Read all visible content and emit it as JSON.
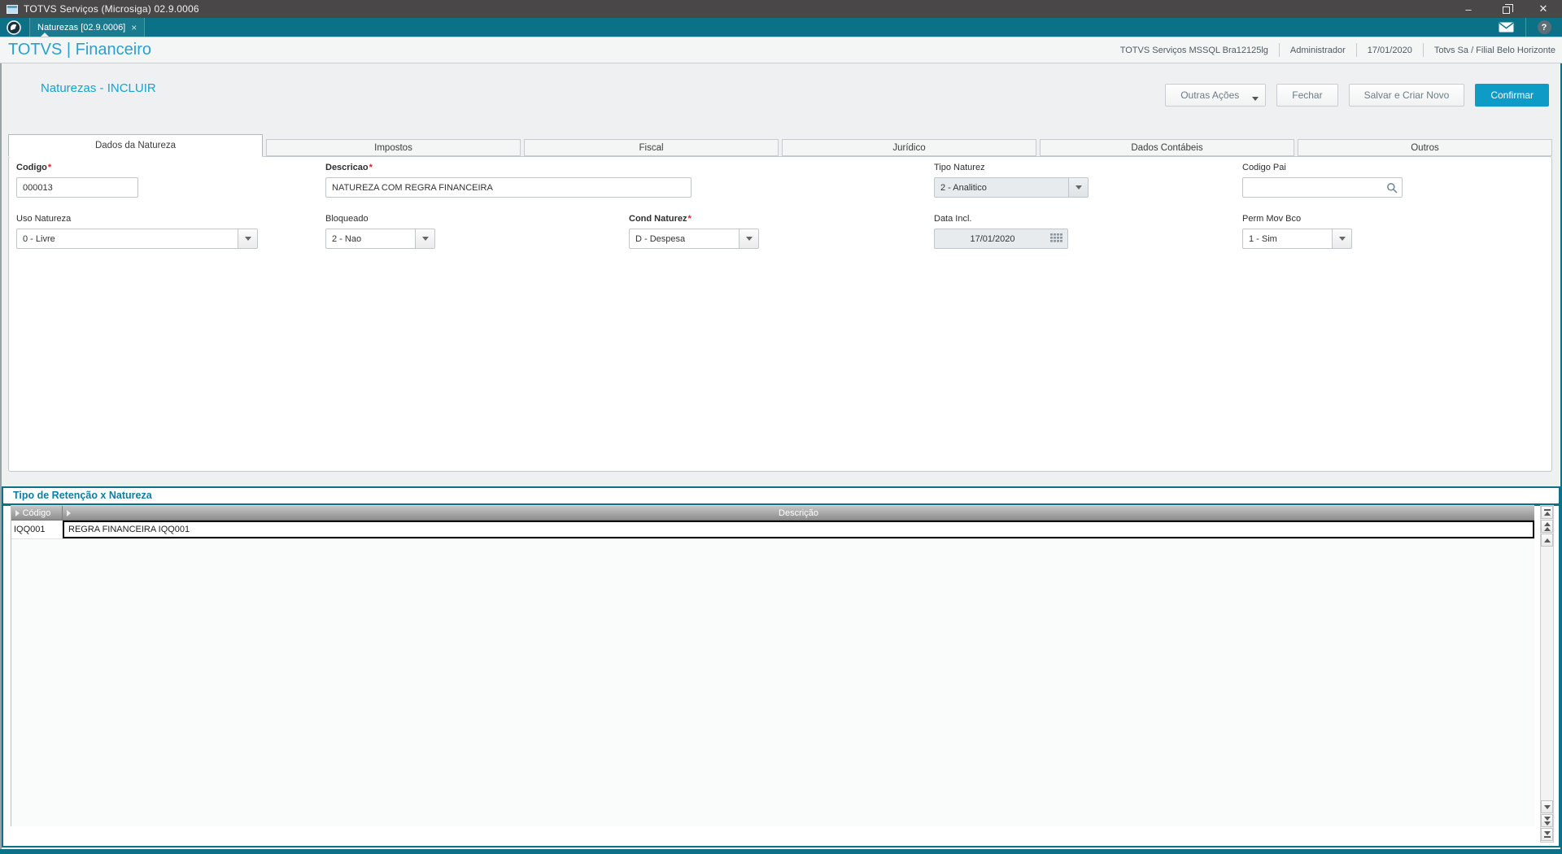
{
  "window": {
    "title": "TOTVS Serviços (Microsiga) 02.9.0006"
  },
  "icons": {
    "minimize": "–",
    "close": "✕",
    "tab_close": "×",
    "help": "?"
  },
  "mditab": {
    "label": "Naturezas [02.9.0006]"
  },
  "header": {
    "brand": "TOTVS | Financeiro",
    "environment": "TOTVS Serviços MSSQL Bra12125lg",
    "user": "Administrador",
    "date": "17/01/2020",
    "company": "Totvs Sa / Filial Belo Horizonte"
  },
  "toolbar": {
    "page_title": "Naturezas - INCLUIR",
    "other_actions_label": "Outras Ações",
    "close_label": "Fechar",
    "save_new_label": "Salvar e Criar Novo",
    "confirm_label": "Confirmar"
  },
  "tabs": {
    "items": [
      {
        "label": "Dados da Natureza",
        "active": true
      },
      {
        "label": "Impostos",
        "active": false
      },
      {
        "label": "Fiscal",
        "active": false
      },
      {
        "label": "Jurídico",
        "active": false
      },
      {
        "label": "Dados Contábeis",
        "active": false
      },
      {
        "label": "Outros",
        "active": false
      }
    ]
  },
  "form": {
    "codigo": {
      "label": "Codigo",
      "required": "*",
      "value": "000013"
    },
    "descricao": {
      "label": "Descricao",
      "required": "*",
      "value": "NATUREZA COM REGRA FINANCEIRA"
    },
    "tipo_naturez": {
      "label": "Tipo Naturez",
      "value": "2 - Analitico"
    },
    "codigo_pai": {
      "label": "Codigo Pai",
      "value": ""
    },
    "uso_natureza": {
      "label": "Uso Natureza",
      "value": "0 - Livre"
    },
    "bloqueado": {
      "label": "Bloqueado",
      "value": "2 - Nao"
    },
    "cond_naturez": {
      "label": "Cond Naturez",
      "required": "*",
      "value": "D - Despesa"
    },
    "data_incl": {
      "label": "Data Incl.",
      "value": "17/01/2020"
    },
    "perm_mov_bco": {
      "label": "Perm Mov Bco",
      "value": "1 - Sim"
    }
  },
  "retencao": {
    "title": "Tipo de Retenção x Natureza",
    "columns": {
      "codigo": "Código",
      "descricao": "Descrição"
    },
    "rows": [
      {
        "codigo": "IQQ001",
        "descricao": "REGRA FINANCEIRA IQQ001"
      }
    ]
  },
  "colors": {
    "accent_teal": "#0b7186",
    "primary_button": "#0e9cc6",
    "brand_blue": "#2ba0cf",
    "required_red": "#e02020",
    "titlebar_gray": "#494747"
  }
}
